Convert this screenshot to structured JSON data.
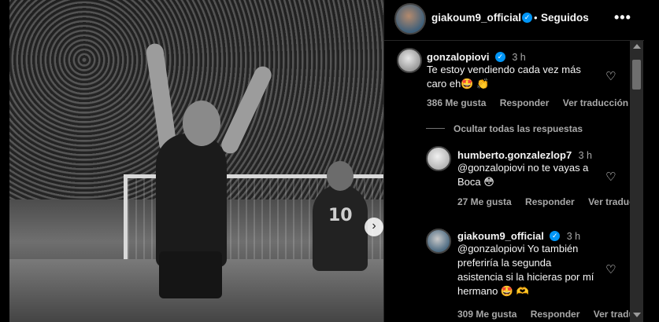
{
  "post": {
    "author": "giakoum9_official",
    "separator": "•",
    "follow_status": "Seguidos",
    "more": "•••",
    "next_arrow": "›",
    "photo": {
      "player_number": "10"
    }
  },
  "comments": [
    {
      "user": "gonzalopiovi",
      "time": "3 h",
      "text_line1": "Te estoy vendiendo cada vez más",
      "text_line2": "caro eh🤩 👏",
      "likes": "386 Me gusta",
      "reply": "Responder",
      "translate": "Ver traducción"
    }
  ],
  "hide_replies": "Ocultar todas las respuestas",
  "replies": [
    {
      "user": "humberto.gonzalezlop7",
      "time": "3 h",
      "text_line1": "@gonzalopiovi no te vayas a",
      "text_line2": "Boca 😳",
      "likes": "27 Me gusta",
      "reply": "Responder",
      "translate": "Ver traducción"
    },
    {
      "user": "giakoum9_official",
      "time": "3 h",
      "text_line1": "@gonzalopiovi Yo también",
      "text_line2": "preferiría la segunda",
      "text_line3": "asistencia si la hicieras por mí",
      "text_line4": "hermano 🤩 🫶",
      "likes": "309 Me gusta",
      "reply": "Responder",
      "translate": "Ver traducción"
    }
  ],
  "icons": {
    "heart": "♡",
    "verified": "✓"
  },
  "colors": {
    "background": "#000000",
    "verified": "#0095f6",
    "muted_text": "#a8a8a8"
  }
}
